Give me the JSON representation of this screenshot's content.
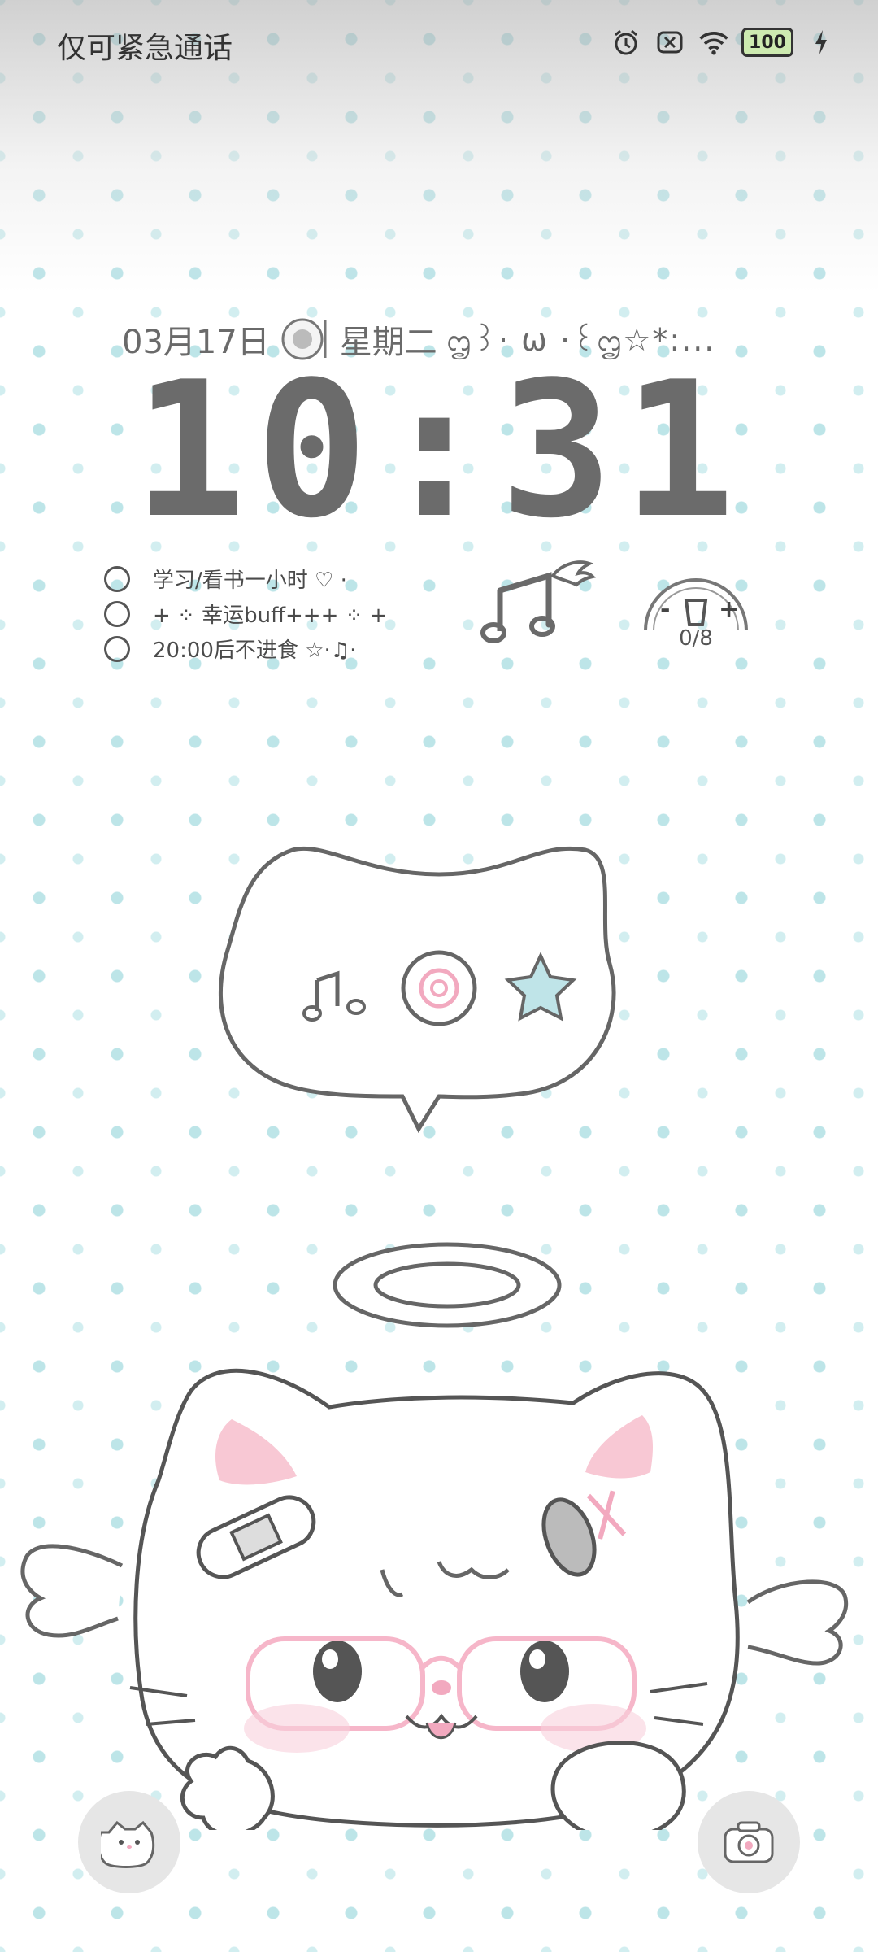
{
  "status_bar": {
    "carrier_text": "仅可紧急通话",
    "battery_level": "100"
  },
  "lockscreen": {
    "date": "03月17日",
    "weekday": "星期二",
    "date_decoration": "ᦗ꒱· ω ·꒰ᦗ☆*:...",
    "time": "10:31"
  },
  "todo_widget": {
    "items": [
      {
        "label": "学习/看书一小时 ♡  ·",
        "done": false
      },
      {
        "label": "+ ⁘ 幸运buff+++ ⁘  +",
        "done": false
      },
      {
        "label": "20:00后不进食 ☆·♫·",
        "done": false
      }
    ]
  },
  "water_widget": {
    "count": "0/8",
    "minus": "-",
    "plus": "+"
  },
  "icons": {
    "music": "music-note-wing-icon",
    "cup": "cup-icon",
    "camera": "camera-icon",
    "cat_shortcut": "cat-face-icon"
  },
  "colors": {
    "clock": "#6b6b6b",
    "star_pattern": "#b6e2e6",
    "pink_accent": "#f7c6d4"
  }
}
